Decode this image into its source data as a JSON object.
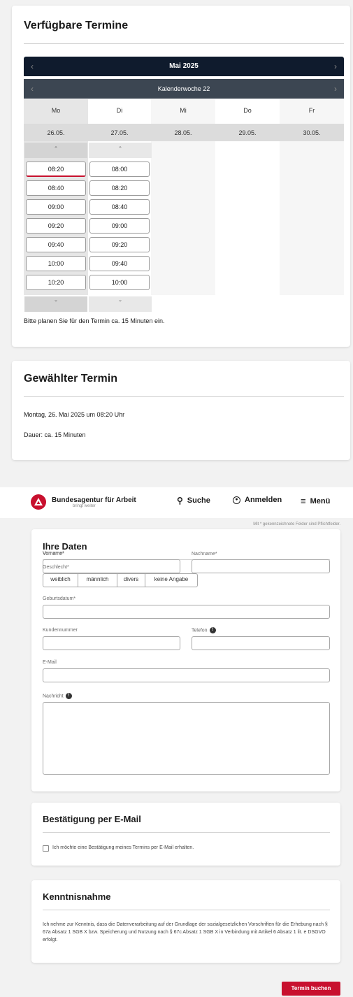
{
  "available": {
    "title": "Verfügbare Termine",
    "month": "Mai 2025",
    "week": "Kalenderwoche 22",
    "days": [
      {
        "name": "Mo",
        "date": "26.05."
      },
      {
        "name": "Di",
        "date": "27.05."
      },
      {
        "name": "Mi",
        "date": "28.05."
      },
      {
        "name": "Do",
        "date": "29.05."
      },
      {
        "name": "Fr",
        "date": "30.05."
      }
    ],
    "mo_slots": [
      "08:20",
      "08:40",
      "09:00",
      "09:20",
      "09:40",
      "10:00",
      "10:20"
    ],
    "di_slots": [
      "08:00",
      "08:20",
      "08:40",
      "09:00",
      "09:20",
      "09:40",
      "10:00"
    ],
    "selected": "08:20",
    "note": "Bitte planen Sie für den Termin ca. 15 Minuten ein."
  },
  "chosen": {
    "title": "Gewählter Termin",
    "datetime": "Montag, 26. Mai 2025 um 08:20 Uhr",
    "duration": "Dauer: ca. 15 Minuten"
  },
  "header": {
    "brand": "Bundesagentur für Arbeit",
    "tagline": "bringt weiter",
    "search": "Suche",
    "login": "Anmelden",
    "menu": "Menü",
    "required_hint": "Mit * gekennzeichnete Felder sind Pflichtfelder."
  },
  "form": {
    "title": "Ihre Daten",
    "vorname": "Vorname*",
    "nachname": "Nachname*",
    "geschlecht": "Geschlecht*",
    "gender_options": [
      "weiblich",
      "männlich",
      "divers",
      "keine Angabe"
    ],
    "geburtsdatum": "Geburtsdatum*",
    "kundennummer": "Kundennummer",
    "telefon": "Telefon",
    "email": "E-Mail",
    "nachricht": "Nachricht"
  },
  "confirm": {
    "title": "Bestätigung per E-Mail",
    "checkbox": "Ich möchte eine Bestätigung meines Termins per E-Mail erhalten."
  },
  "notice": {
    "title": "Kenntnisnahme",
    "text": "Ich nehme zur Kenntnis, dass die Datenverarbeitung auf der Grundlage der sozialgesetzlichen Vorschriften für die Erhebung nach § 67a Absatz 1 SGB X bzw. Speicherung und Nutzung nach § 67c Absatz 1 SGB X in Verbindung mit Artikel 6 Absatz 1 lit. e DSGVO erfolgt."
  },
  "submit": "Termin buchen",
  "colors": {
    "accent": "#c8102e",
    "dark": "#0f1b2d"
  }
}
